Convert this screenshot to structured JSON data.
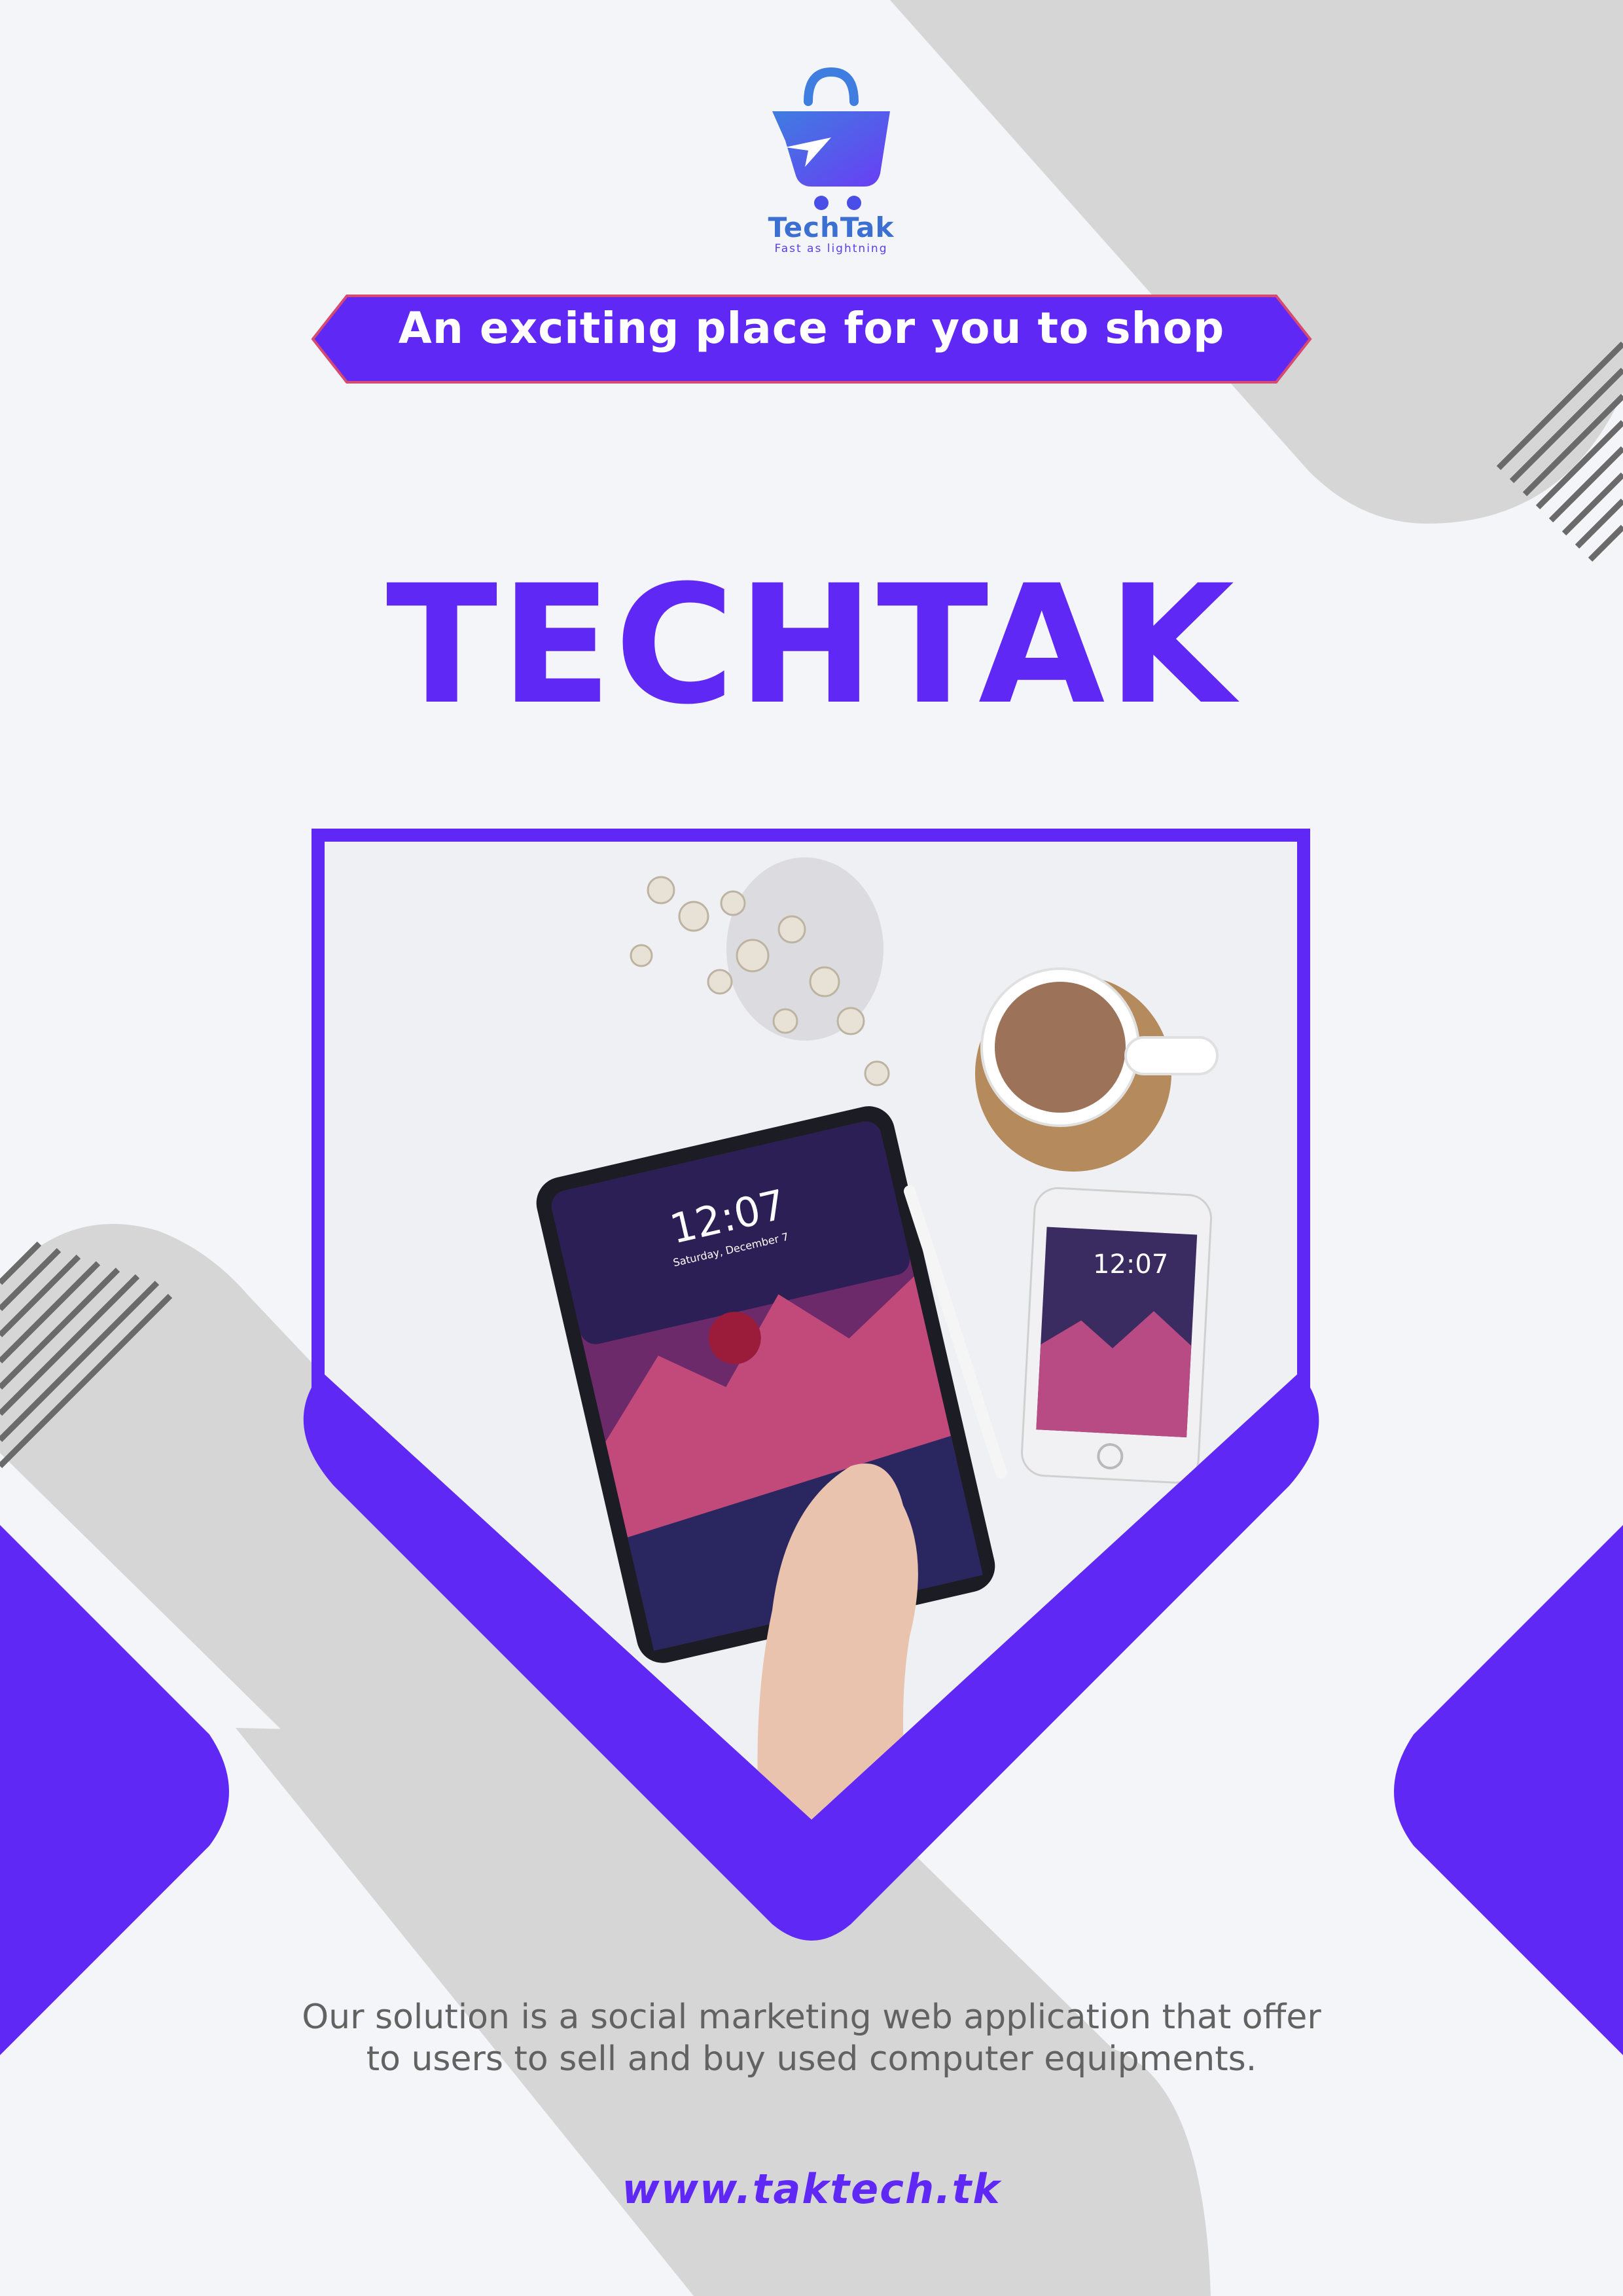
{
  "brand": {
    "name": "TechTak",
    "tagline": "Fast as lightning"
  },
  "banner": {
    "text": "An exciting place for you to shop"
  },
  "headline": "TECHTAK",
  "photo": {
    "tablet_time": "12:07",
    "tablet_date": "Saturday, December 7",
    "phone_time": "12:07"
  },
  "description": {
    "line1": "Our solution is a social marketing web application that offer",
    "line2": "to users to sell and buy used computer equipments."
  },
  "url": "www.taktech.tk",
  "colors": {
    "brand_purple": "#6028f5",
    "background": "#f4f5f8",
    "shape_gray": "#d6d6d6",
    "text_gray": "#626262"
  },
  "icons": [
    "shopping-bag-cart-icon"
  ]
}
